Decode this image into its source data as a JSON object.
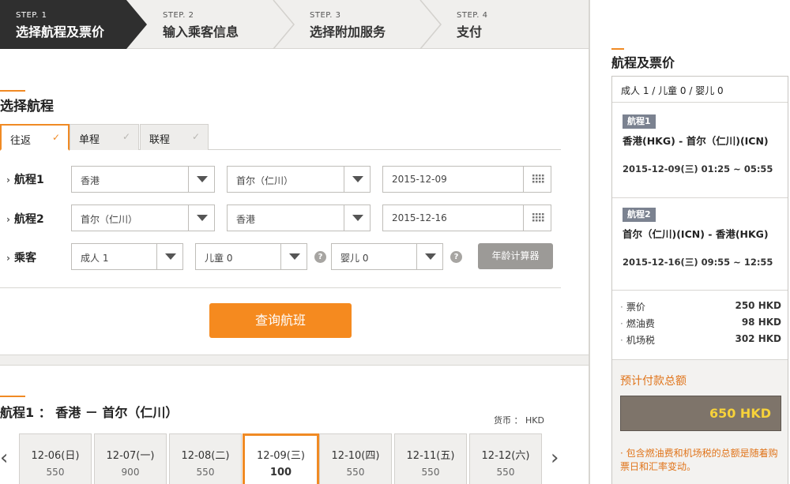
{
  "steps": [
    {
      "num": "STEP. 1",
      "label": "选择航程及票价",
      "active": true
    },
    {
      "num": "STEP. 2",
      "label": "输入乘客信息",
      "active": false
    },
    {
      "num": "STEP. 3",
      "label": "选择附加服务",
      "active": false
    },
    {
      "num": "STEP. 4",
      "label": "支付",
      "active": false
    }
  ],
  "search": {
    "title": "选择航程",
    "tabs": [
      {
        "label": "往返",
        "active": true
      },
      {
        "label": "单程",
        "active": false
      },
      {
        "label": "联程",
        "active": false
      }
    ],
    "leg1": {
      "label": "航程1",
      "from": "香港",
      "to": "首尔（仁川）",
      "date": "2015-12-09"
    },
    "leg2": {
      "label": "航程2",
      "from": "首尔（仁川）",
      "to": "香港",
      "date": "2015-12-16"
    },
    "passengers": {
      "label": "乘客",
      "adult": "成人 1",
      "child": "儿童 0",
      "infant": "婴儿 0",
      "help": "?",
      "age_calc": "年龄计算器"
    },
    "search_button": "查询航班"
  },
  "results": {
    "title": "航程1 ： 香港 － 首尔（仁川）",
    "currency": "货币 ： HKD",
    "prev": "‹",
    "next": "›",
    "dates": [
      {
        "date": "12-06(日)",
        "price": "550",
        "selected": false
      },
      {
        "date": "12-07(一)",
        "price": "900",
        "selected": false
      },
      {
        "date": "12-08(二)",
        "price": "550",
        "selected": false
      },
      {
        "date": "12-09(三)",
        "price": "100",
        "selected": true
      },
      {
        "date": "12-10(四)",
        "price": "550",
        "selected": false
      },
      {
        "date": "12-11(五)",
        "price": "550",
        "selected": false
      },
      {
        "date": "12-12(六)",
        "price": "550",
        "selected": false
      }
    ]
  },
  "sidebar": {
    "title": "航程及票价",
    "pax": "成人 1 / 儿童 0 / 婴儿 0",
    "leg1": {
      "badge": "航程1",
      "route": "香港(HKG) - 首尔（仁川)(ICN)",
      "times": "2015-12-09(三) 01:25 ~ 05:55"
    },
    "leg2": {
      "badge": "航程2",
      "route": "首尔（仁川)(ICN) - 香港(HKG)",
      "times": "2015-12-16(三) 09:55 ~ 12:55"
    },
    "fees": [
      {
        "label": "票价",
        "amount": "250 HKD"
      },
      {
        "label": "燃油费",
        "amount": "98 HKD"
      },
      {
        "label": "机场税",
        "amount": "302 HKD"
      }
    ],
    "total_label": "预计付款总额",
    "total": "650 HKD",
    "note": "· 包含燃油费和机场税的总额是随着购票日和汇率变动。"
  },
  "colors": {
    "accent": "#f08a24",
    "button": "#f58a1f",
    "active_step": "#2f2f2f",
    "total_text": "#f7d23a"
  }
}
